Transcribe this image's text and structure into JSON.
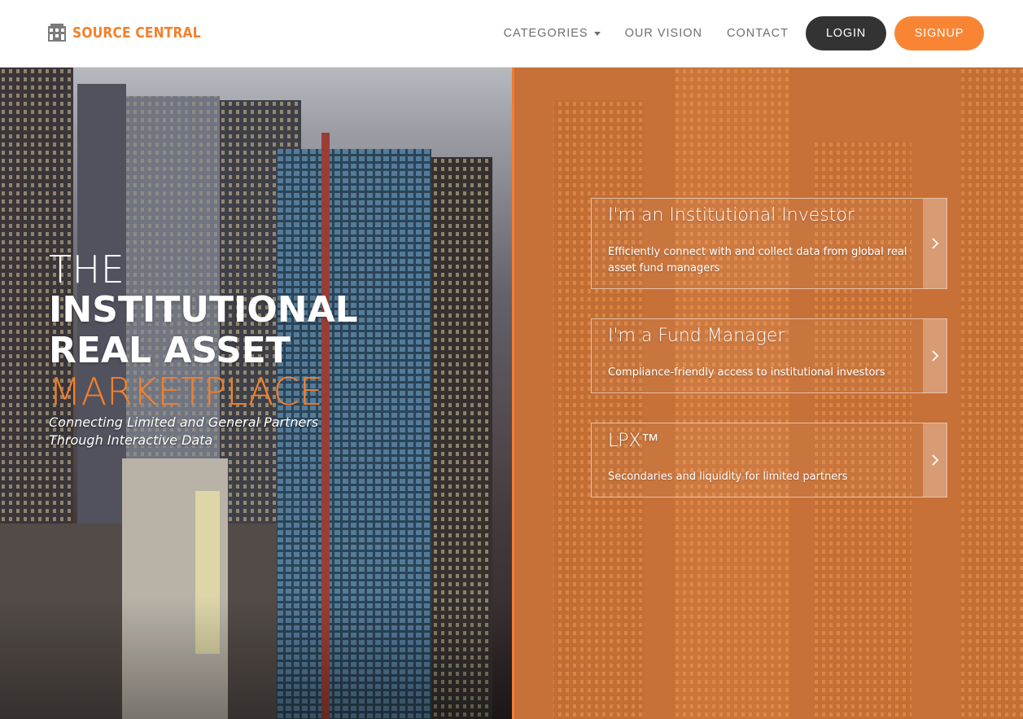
{
  "brand": {
    "name": "SOURCE CENTRAL",
    "logo_icon": "building-grid-icon",
    "color": "#f4802b"
  },
  "nav": {
    "categories": "CATEGORIES",
    "vision": "OUR VISION",
    "contact": "CONTACT",
    "login": "LOGIN",
    "signup": "SIGNUP"
  },
  "hero": {
    "line1": "THE",
    "line2": "INSTITUTIONAL",
    "line3": "REAL ASSET",
    "line4": "MARKETPLACE",
    "tagline1": "Connecting Limited and General Partners",
    "tagline2": "Through Interactive Data"
  },
  "cards": [
    {
      "title": "I'm an Institutional Investor",
      "description": "Efficiently connect with and collect data from global real asset fund managers"
    },
    {
      "title": "I'm a Fund Manager",
      "description": "Compliance-friendly access to institutional investors"
    },
    {
      "title": "LPX™",
      "description": "Secondaries and liquidity for limited partners"
    }
  ],
  "colors": {
    "accent": "#f4802b",
    "login_bg": "#333333",
    "signup_bg": "#f98534"
  }
}
